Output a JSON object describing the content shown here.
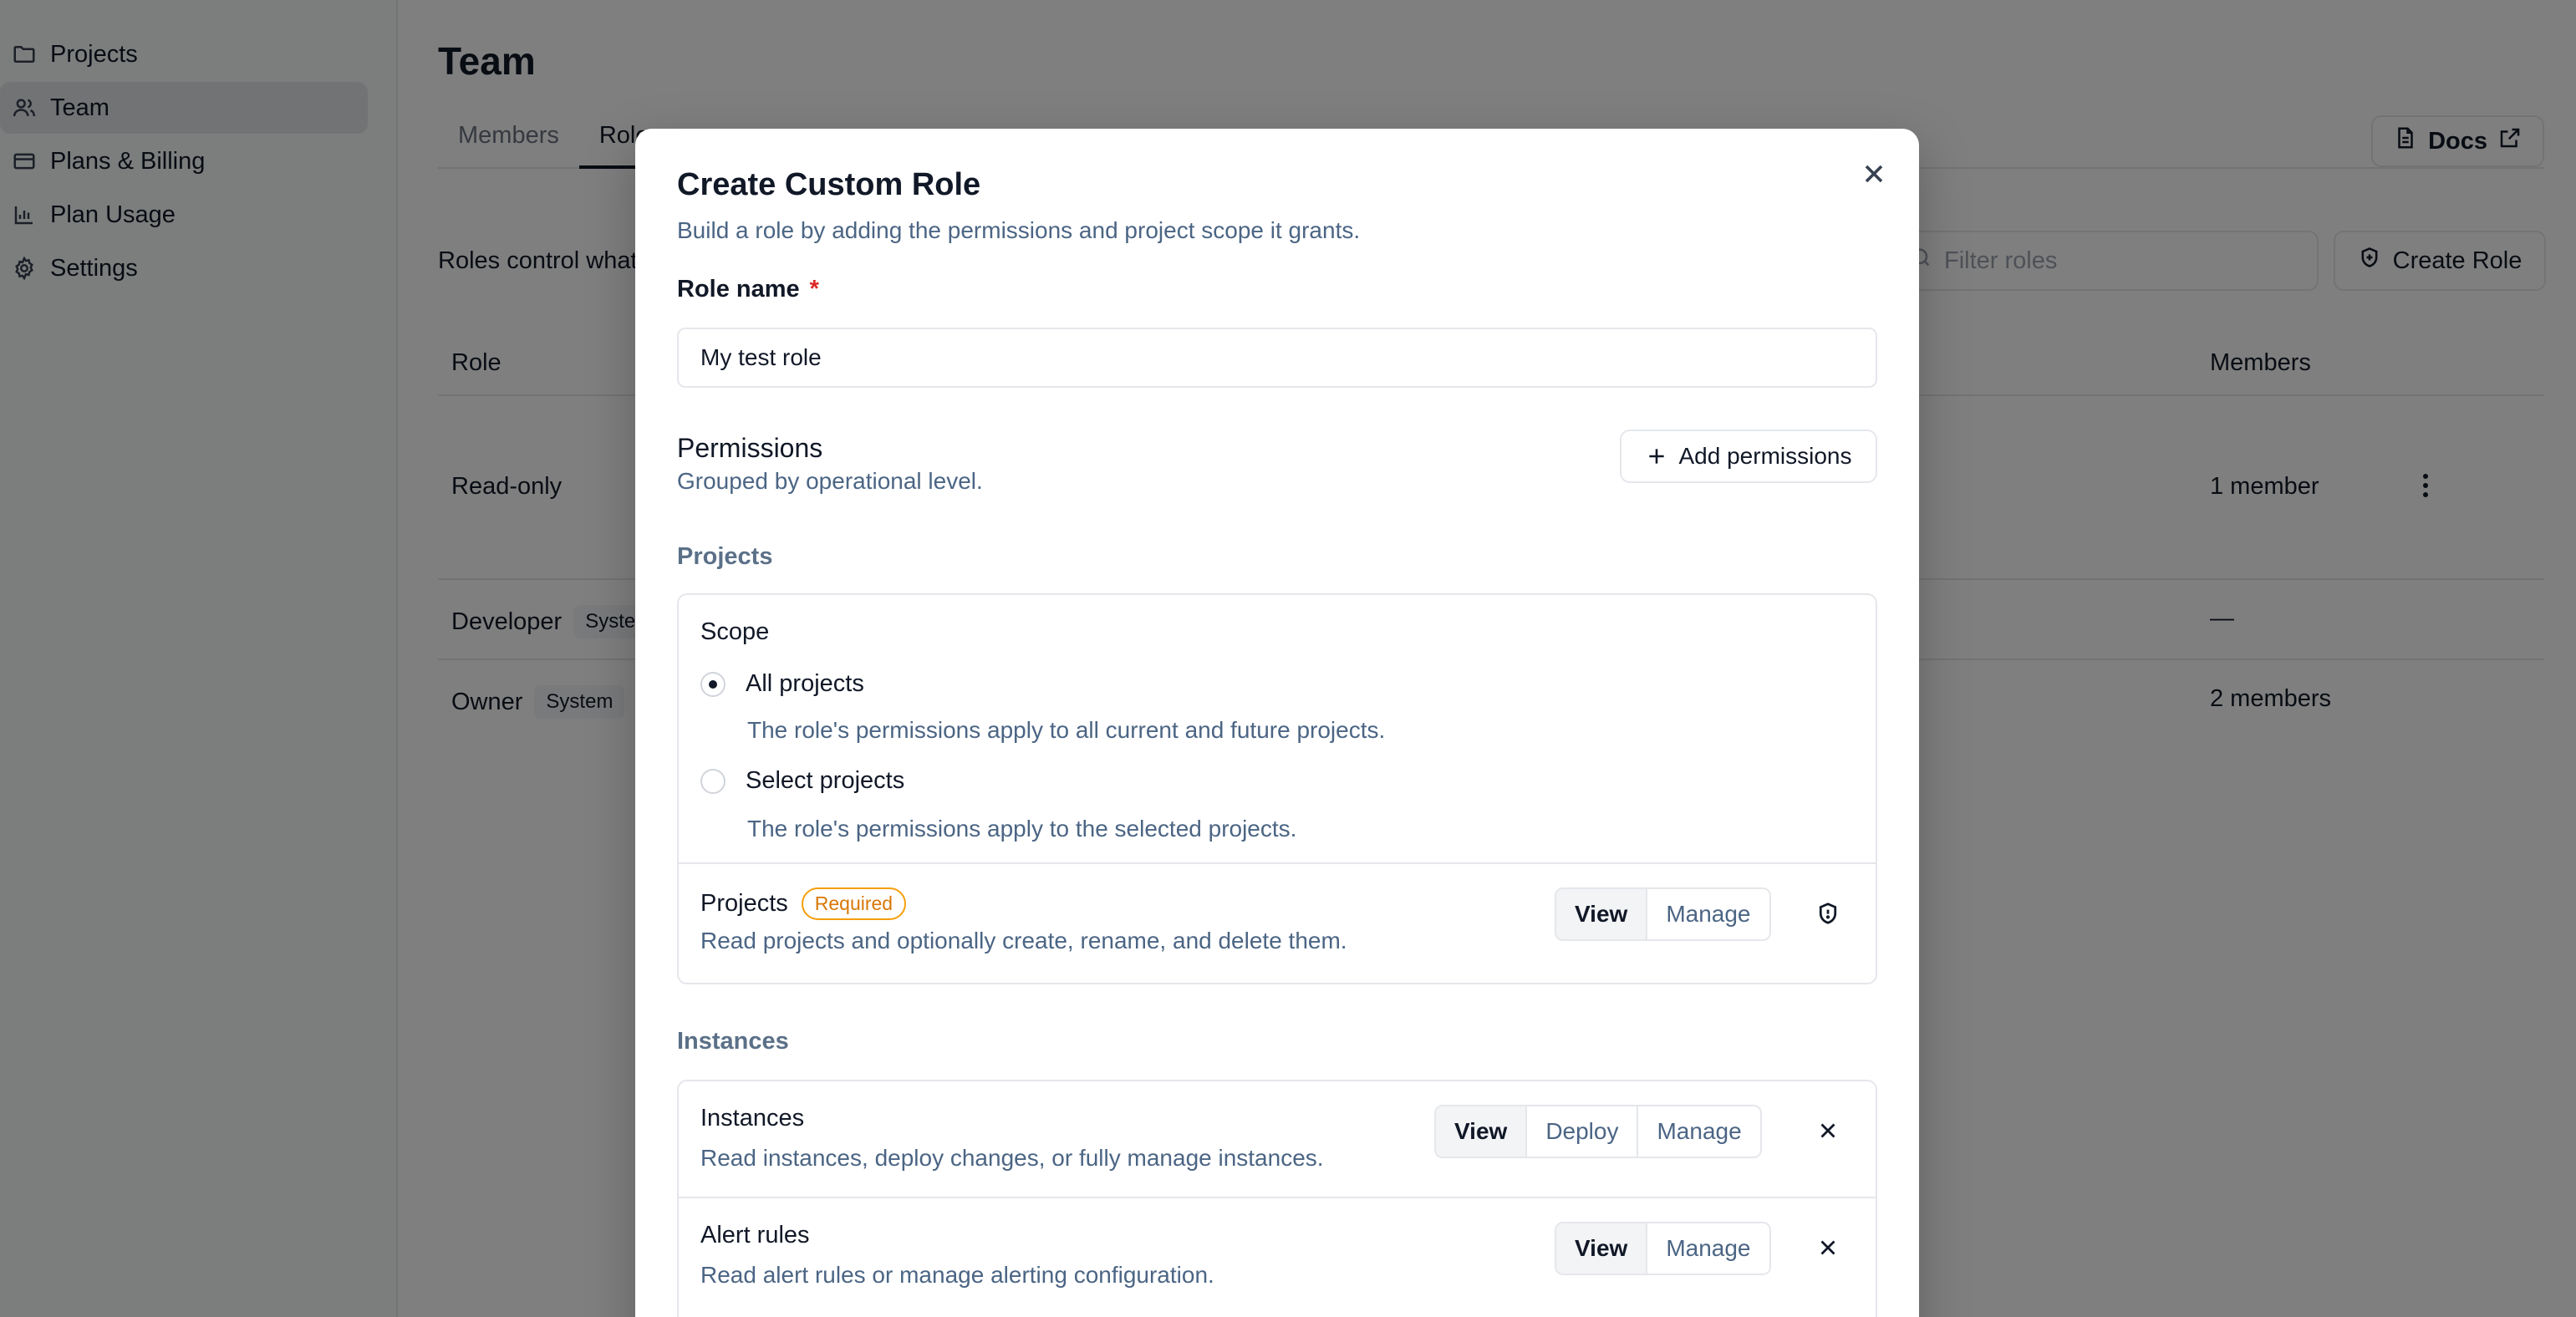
{
  "sidebar": {
    "items": [
      {
        "label": "Projects",
        "icon": "folder-icon"
      },
      {
        "label": "Team",
        "icon": "users-icon",
        "active": true
      },
      {
        "label": "Plans & Billing",
        "icon": "credit-card-icon"
      },
      {
        "label": "Plan Usage",
        "icon": "bar-chart-icon"
      },
      {
        "label": "Settings",
        "icon": "gear-icon"
      }
    ]
  },
  "page": {
    "title": "Team",
    "tabs": [
      "Members",
      "Roles"
    ],
    "active_tab": "Roles",
    "docs_label": "Docs",
    "roles_description": "Roles control what",
    "filter_placeholder": "Filter roles",
    "create_role_label": "Create Role"
  },
  "table": {
    "col_role": "Role",
    "col_members": "Members",
    "rows": [
      {
        "name": "Read-only",
        "badge": "",
        "members": "1 member"
      },
      {
        "name": "Developer",
        "badge": "System",
        "members": "—"
      },
      {
        "name": "Owner",
        "badge": "System",
        "members": "2 members"
      }
    ]
  },
  "modal": {
    "title": "Create Custom Role",
    "subtitle": "Build a role by adding the permissions and project scope it grants.",
    "role_name_label": "Role name",
    "required_mark": "*",
    "role_name_value": "My test role",
    "permissions_title": "Permissions",
    "permissions_subtitle": "Grouped by operational level.",
    "add_permissions_label": "Add permissions",
    "projects_section": {
      "heading": "Projects",
      "scope_title": "Scope",
      "options": [
        {
          "label": "All projects",
          "description": "The role's permissions apply to all current and future projects.",
          "checked": true
        },
        {
          "label": "Select projects",
          "description": "The role's permissions apply to the selected projects.",
          "checked": false
        }
      ],
      "permission": {
        "name": "Projects",
        "badge": "Required",
        "description": "Read projects and optionally create, rename, and delete them.",
        "levels": [
          "View",
          "Manage"
        ],
        "selected": "View"
      }
    },
    "instances_section": {
      "heading": "Instances",
      "permissions": [
        {
          "name": "Instances",
          "description": "Read instances, deploy changes, or fully manage instances.",
          "levels": [
            "View",
            "Deploy",
            "Manage"
          ],
          "selected": "View"
        },
        {
          "name": "Alert rules",
          "description": "Read alert rules or manage alerting configuration.",
          "levels": [
            "View",
            "Manage"
          ],
          "selected": "View"
        }
      ]
    }
  },
  "colors": {
    "overlay": "#000000",
    "required": "#dc2626",
    "required_badge": "#d97706",
    "muted_text": "#4b6584"
  }
}
